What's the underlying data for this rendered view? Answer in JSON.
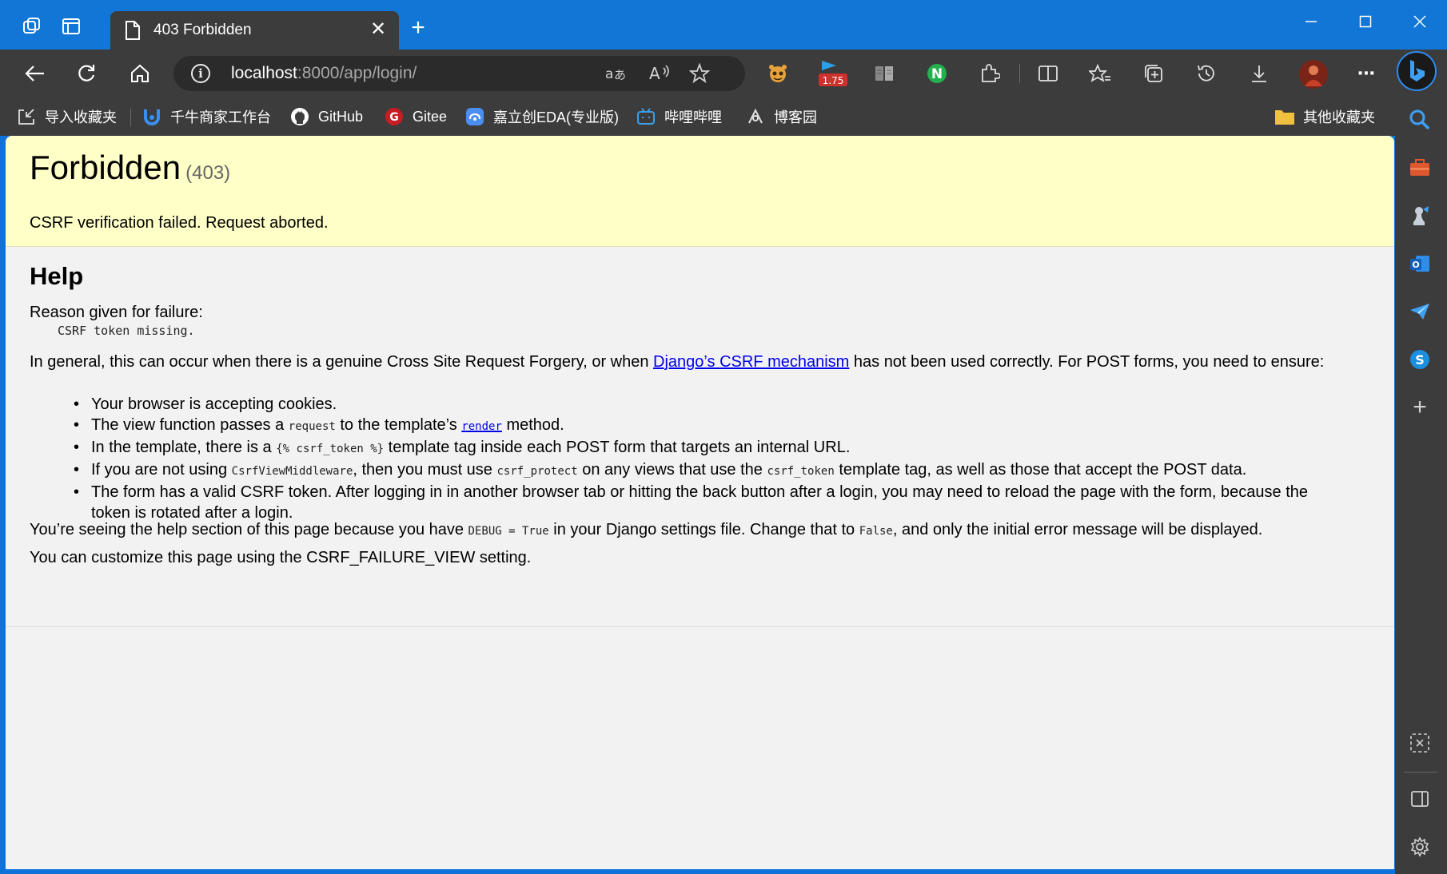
{
  "browser": {
    "tab": {
      "title": "403 Forbidden"
    },
    "address": {
      "host": "localhost",
      "rest": ":8000/app/login/"
    },
    "extension_badge": "1.75",
    "favorites": [
      {
        "label": "导入收藏夹",
        "icon": "import-favorites-icon"
      },
      {
        "label": "千牛商家工作台",
        "icon": "qianniu-icon"
      },
      {
        "label": "GitHub",
        "icon": "github-icon"
      },
      {
        "label": "Gitee",
        "icon": "gitee-icon"
      },
      {
        "label": "嘉立创EDA(专业版)",
        "icon": "jlc-eda-icon"
      },
      {
        "label": "哔哩哔哩",
        "icon": "bilibili-icon"
      },
      {
        "label": "博客园",
        "icon": "cnblogs-icon"
      }
    ],
    "other_favorites": "其他收藏夹",
    "colors": {
      "titlebar": "#1276d6",
      "chrome": "#3c3c3c",
      "page_bg": "#f2f2f2",
      "summary_bg": "#ffffc8",
      "link": "#0000ee"
    }
  },
  "page": {
    "title": "Forbidden",
    "code": "(403)",
    "summary": "CSRF verification failed. Request aborted.",
    "help_heading": "Help",
    "reason_label": "Reason given for failure:",
    "reason": "CSRF token missing.",
    "intro_1": "In general, this can occur when there is a genuine Cross Site Request Forgery, or when ",
    "intro_link": "Django’s CSRF mechanism",
    "intro_2": " has not been used correctly. For POST forms, you need to ensure:",
    "b1": "Your browser is accepting cookies.",
    "b2_1": "The view function passes a ",
    "b2_code": "request",
    "b2_2": " to the template’s ",
    "b2_link": "render",
    "b2_3": " method.",
    "b3_1": "In the template, there is a ",
    "b3_code": "{% csrf_token %}",
    "b3_2": " template tag inside each POST form that targets an internal URL.",
    "b4_1": "If you are not using ",
    "b4_code1": "CsrfViewMiddleware",
    "b4_2": ", then you must use ",
    "b4_code2": "csrf_protect",
    "b4_3": " on any views that use the ",
    "b4_code3": "csrf_token",
    "b4_4": " template tag, as well as those that accept the POST data.",
    "b5": "The form has a valid CSRF token. After logging in in another browser tab or hitting the back button after a login, you may need to reload the page with the form, because the token is rotated after a login.",
    "debug_1": "You’re seeing the help section of this page because you have ",
    "debug_code1": "DEBUG = True",
    "debug_2": " in your Django settings file. Change that to ",
    "debug_code2": "False",
    "debug_3": ", and only the initial error message will be displayed.",
    "customize": "You can customize this page using the CSRF_FAILURE_VIEW setting."
  }
}
